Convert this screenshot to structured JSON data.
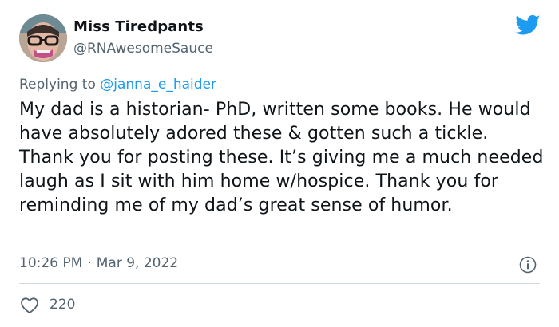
{
  "user": {
    "display_name": "Miss Tiredpants",
    "handle": "@RNAwesomeSauce",
    "avatar_icon": "avatar"
  },
  "reply": {
    "prefix": "Replying to ",
    "mention": "@janna_e_haider"
  },
  "tweet": {
    "text": "My dad is a historian- PhD, written some books. He would have absolutely adored these & gotten such a tickle. Thank you for posting these. It’s giving me a much needed laugh as I sit with him home w/hospice. Thank you for reminding me of my dad’s great sense of humor.",
    "time": "10:26 PM",
    "separator": "·",
    "date": "Mar 9, 2022",
    "likes": "220"
  },
  "icons": {
    "brand": "twitter-bird-icon",
    "info": "info-icon",
    "like": "heart-icon"
  },
  "colors": {
    "brand": "#1d9bf0",
    "text": "#0f1419",
    "secondary": "#536471",
    "divider": "#cfd9de"
  }
}
